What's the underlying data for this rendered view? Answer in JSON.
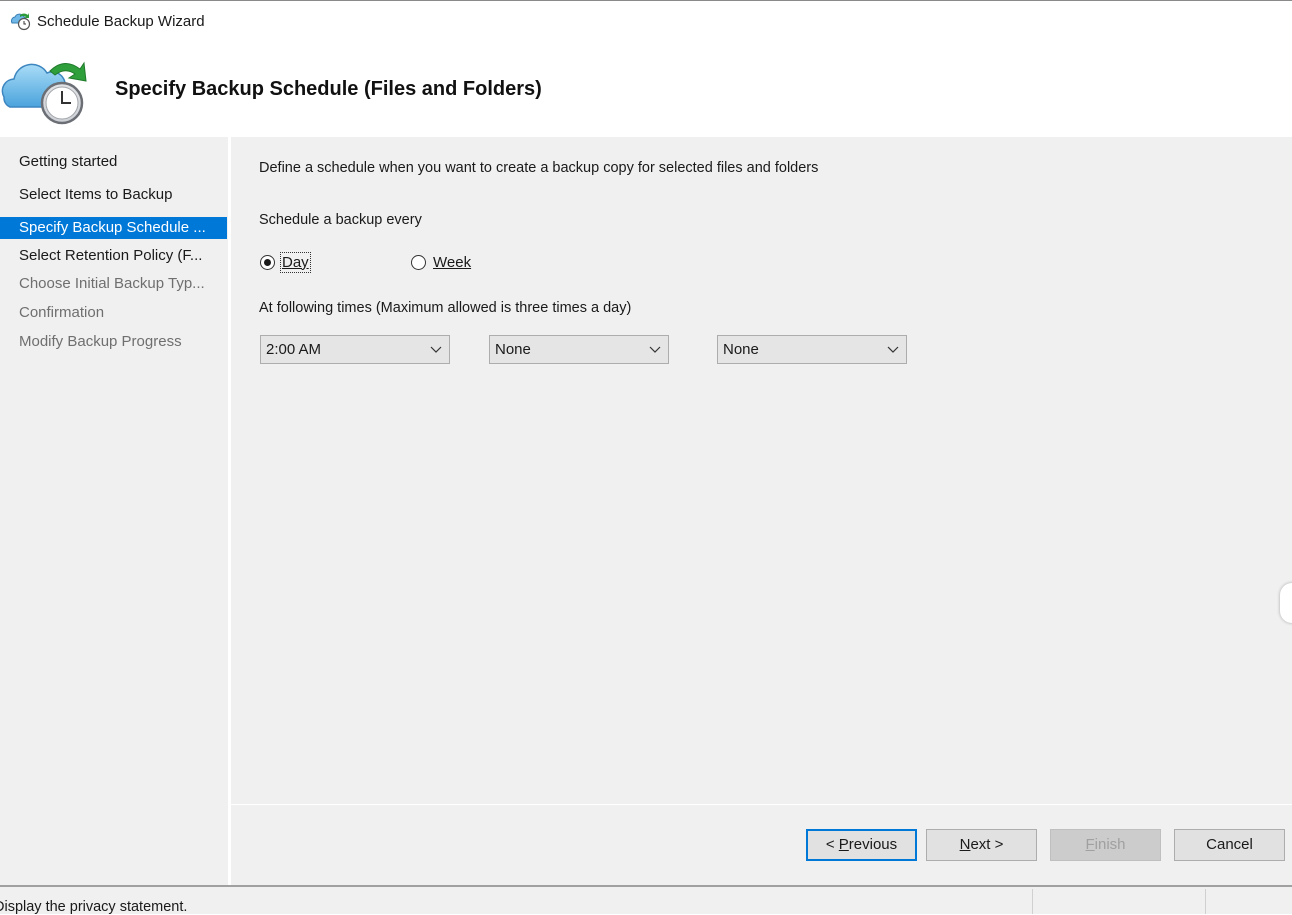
{
  "window": {
    "title": "Schedule Backup Wizard"
  },
  "header": {
    "heading": "Specify Backup Schedule (Files and Folders)"
  },
  "nav": {
    "items": [
      {
        "label": "Getting started",
        "state": "normal"
      },
      {
        "label": "Select Items to Backup",
        "state": "normal"
      },
      {
        "label": "Specify Backup Schedule ...",
        "state": "active"
      },
      {
        "label": "Select Retention Policy (F...",
        "state": "normal"
      },
      {
        "label": "Choose Initial Backup Typ...",
        "state": "disabled"
      },
      {
        "label": "Confirmation",
        "state": "disabled"
      },
      {
        "label": "Modify Backup Progress",
        "state": "disabled"
      }
    ]
  },
  "main": {
    "description": "Define a schedule when you want to create a backup copy for selected files and folders",
    "schedule_label": "Schedule a backup every",
    "radios": {
      "day_label": "Day",
      "week_label": "Week",
      "selected": "Day"
    },
    "times_label": "At following times (Maximum allowed is three times a day)",
    "times": [
      "2:00 AM",
      "None",
      "None"
    ]
  },
  "buttons": {
    "previous_prefix": "< ",
    "previous_accel": "P",
    "previous_rest": "revious",
    "next_accel": "N",
    "next_rest": "ext >",
    "finish_accel": "F",
    "finish_rest": "inish",
    "cancel": "Cancel"
  },
  "status": {
    "text": "Display the privacy statement."
  },
  "colors": {
    "accent": "#0078d7",
    "panel": "#f0f0f0"
  }
}
